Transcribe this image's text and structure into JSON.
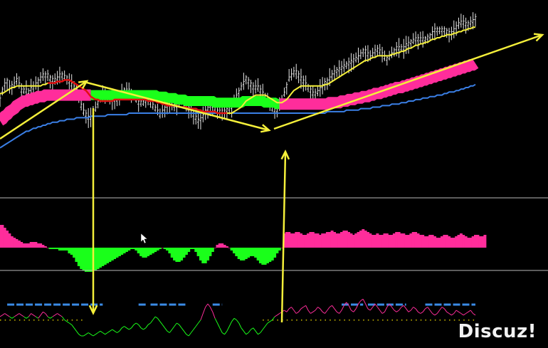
{
  "watermark": "Discuz!",
  "colors": {
    "background": "#000000",
    "price_bar": "#e6e6e6",
    "fast_ma": "#f4ef3a",
    "mid_ma_up": "#ff2d9b",
    "mid_ma_down": "#1aff1a",
    "slow_ma": "#3a7fe6",
    "red_ma": "#e01010",
    "annotation": "#f4ef3a",
    "separator": "#b8b8b8",
    "histogram_pos": "#ff2d9b",
    "histogram_neg": "#1aff1a",
    "osc_pos": "#ff2d9b",
    "osc_neg": "#1aff1a",
    "signal_dash": "#3a8be6",
    "zero_dots": "#d4c000"
  },
  "chart_data": [
    {
      "type": "line",
      "panel": "price",
      "bars": 200,
      "close": [
        34,
        40,
        44,
        46,
        42,
        43,
        44,
        47,
        44,
        40,
        40,
        40,
        39,
        41,
        42,
        44,
        46,
        48,
        50,
        50,
        50,
        48,
        47,
        47,
        48,
        50,
        50,
        49,
        48,
        46,
        44,
        42,
        40,
        36,
        30,
        26,
        24,
        22,
        22,
        24,
        28,
        32,
        36,
        38,
        38,
        37,
        35,
        34,
        34,
        34,
        36,
        38,
        40,
        40,
        40,
        38,
        36,
        34,
        32,
        32,
        32,
        33,
        34,
        32,
        30,
        28,
        26,
        24,
        26,
        28,
        30,
        32,
        32,
        30,
        30,
        32,
        34,
        33,
        30,
        28,
        26,
        24,
        22,
        20,
        21,
        23,
        26,
        28,
        30,
        30,
        28,
        26,
        26,
        26,
        26,
        27,
        28,
        29,
        32,
        36,
        39,
        42,
        45,
        48,
        46,
        44,
        42,
        42,
        42,
        40,
        38,
        36,
        34,
        31,
        28,
        27,
        27,
        29,
        33,
        38,
        43,
        48,
        50,
        52,
        52,
        50,
        48,
        46,
        44,
        42,
        40,
        38,
        38,
        39,
        41,
        43,
        45,
        46,
        48,
        50,
        52,
        53,
        54,
        55,
        56,
        57,
        58,
        59,
        60,
        61,
        62,
        64,
        66,
        66,
        64,
        62,
        64,
        66,
        67,
        66,
        64,
        62,
        61,
        62,
        64,
        66,
        68,
        68,
        68,
        68,
        70,
        71,
        72,
        73,
        74,
        74,
        74,
        74,
        74,
        75,
        76,
        78,
        80,
        80,
        80,
        80,
        80,
        79,
        78,
        78,
        80,
        82,
        84,
        85,
        85,
        84,
        84,
        85,
        86,
        88
      ],
      "fast_ma": [
        38,
        38,
        39,
        40,
        41,
        42,
        42,
        43,
        43,
        43,
        43,
        43,
        43,
        43,
        43,
        43,
        43,
        43,
        44,
        44,
        45,
        45,
        45,
        45,
        46,
        46,
        46,
        47,
        47,
        47,
        46,
        45,
        44,
        43,
        42,
        41,
        40,
        38,
        36,
        35,
        34,
        34,
        33,
        33,
        33,
        33,
        33,
        33,
        34,
        34,
        34,
        34,
        34,
        34,
        34,
        34,
        34,
        34,
        34,
        34,
        34,
        34,
        33,
        33,
        33,
        33,
        32,
        32,
        31,
        31,
        30,
        30,
        30,
        30,
        30,
        29,
        29,
        29,
        29,
        28,
        28,
        28,
        28,
        27,
        27,
        26,
        26,
        26,
        26,
        26,
        26,
        25,
        25,
        25,
        25,
        25,
        25,
        25,
        26,
        27,
        28,
        29,
        31,
        33,
        34,
        35,
        36,
        37,
        37,
        37,
        37,
        37,
        36,
        35,
        34,
        33,
        32,
        32,
        32,
        33,
        34,
        36,
        38,
        40,
        41,
        42,
        43,
        43,
        43,
        43,
        43,
        43,
        43,
        43,
        43,
        43,
        44,
        44,
        45,
        46,
        47,
        48,
        49,
        50,
        51,
        52,
        53,
        54,
        55,
        56,
        57,
        58,
        59,
        60,
        60,
        61,
        62,
        62,
        63,
        63,
        63,
        63,
        63,
        63,
        64,
        64,
        65,
        65,
        66,
        66,
        67,
        68,
        68,
        69,
        70,
        70,
        71,
        71,
        72,
        72,
        73,
        74,
        74,
        75,
        75,
        76,
        76,
        77,
        77,
        77,
        78,
        78,
        79,
        79,
        80,
        80,
        81,
        81,
        82,
        82
      ],
      "mid_ma": [
        20,
        21,
        23,
        24,
        26,
        27,
        28,
        30,
        31,
        32,
        33,
        33,
        34,
        34,
        35,
        35,
        36,
        36,
        36,
        37,
        37,
        37,
        37,
        37,
        37,
        37,
        37,
        37,
        37,
        37,
        37,
        37,
        37,
        37,
        37,
        37,
        37,
        37,
        37,
        37,
        37,
        37,
        37,
        37,
        37,
        37,
        37,
        37,
        37,
        37,
        37,
        37,
        37,
        37,
        37,
        37,
        37,
        37,
        37,
        37,
        37,
        37,
        37,
        37,
        37,
        37,
        36,
        36,
        36,
        36,
        35,
        35,
        35,
        35,
        34,
        34,
        34,
        34,
        33,
        33,
        33,
        33,
        33,
        33,
        33,
        33,
        33,
        33,
        33,
        33,
        32,
        32,
        32,
        32,
        32,
        32,
        32,
        32,
        32,
        32,
        32,
        32,
        33,
        33,
        33,
        33,
        33,
        33,
        33,
        33,
        33,
        32,
        32,
        32,
        32,
        32,
        31,
        31,
        31,
        31,
        31,
        31,
        31,
        31,
        31,
        31,
        31,
        31,
        31,
        31,
        31,
        31,
        31,
        31,
        31,
        31,
        31,
        31,
        32,
        32,
        32,
        32,
        32,
        33,
        33,
        33,
        34,
        34,
        34,
        35,
        35,
        35,
        36,
        36,
        36,
        37,
        37,
        38,
        38,
        38,
        39,
        39,
        40,
        40,
        41,
        41,
        42,
        42,
        42,
        43,
        43,
        44,
        44,
        45,
        45,
        46,
        46,
        47,
        47,
        48,
        48,
        49,
        49,
        50,
        50,
        51,
        51,
        52,
        52,
        53,
        53,
        54,
        54,
        55,
        55,
        56,
        56,
        57,
        57,
        58,
        58
      ],
      "slow_ma": [
        2,
        3,
        4,
        5,
        6,
        7,
        8,
        9,
        10,
        11,
        12,
        13,
        13,
        14,
        15,
        15,
        16,
        16,
        17,
        17,
        18,
        18,
        19,
        19,
        19,
        20,
        20,
        20,
        21,
        21,
        21,
        21,
        22,
        22,
        22,
        22,
        22,
        22,
        23,
        23,
        23,
        23,
        23,
        23,
        23,
        24,
        24,
        24,
        24,
        24,
        24,
        24,
        24,
        24,
        25,
        25,
        25,
        25,
        25,
        25,
        25,
        25,
        25,
        25,
        25,
        25,
        25,
        25,
        25,
        25,
        25,
        25,
        25,
        25,
        25,
        25,
        25,
        25,
        25,
        25,
        25,
        25,
        25,
        25,
        25,
        25,
        25,
        25,
        25,
        25,
        25,
        25,
        25,
        25,
        25,
        25,
        25,
        25,
        25,
        25,
        25,
        25,
        25,
        25,
        25,
        25,
        25,
        25,
        25,
        25,
        25,
        25,
        25,
        25,
        25,
        25,
        25,
        25,
        25,
        25,
        25,
        25,
        25,
        25,
        25,
        25,
        25,
        25,
        25,
        25,
        25,
        25,
        25,
        25,
        25,
        25,
        25,
        26,
        26,
        26,
        26,
        26,
        26,
        26,
        26,
        27,
        27,
        27,
        27,
        27,
        27,
        28,
        28,
        28,
        28,
        28,
        29,
        29,
        29,
        29,
        30,
        30,
        30,
        30,
        31,
        31,
        31,
        31,
        32,
        32,
        32,
        33,
        33,
        33,
        34,
        34,
        34,
        35,
        35,
        35,
        36,
        36,
        36,
        37,
        37,
        37,
        38,
        38,
        39,
        39,
        39,
        40,
        40,
        41,
        41,
        42,
        42,
        43,
        43,
        44,
        44,
        45
      ],
      "red_ma_segment": [
        20,
        95
      ],
      "mid_ma_down_segment": [
        38,
        117
      ]
    },
    {
      "type": "bar",
      "panel": "histogram",
      "values": [
        0.8,
        0.8,
        0.7,
        0.6,
        0.5,
        0.4,
        0.35,
        0.3,
        0.25,
        0.2,
        0.15,
        0.15,
        0.15,
        0.2,
        0.2,
        0.2,
        0.15,
        0.15,
        0.1,
        0.05,
        0.0,
        -0.05,
        -0.05,
        -0.05,
        -0.05,
        -0.1,
        -0.1,
        -0.1,
        -0.1,
        -0.2,
        -0.25,
        -0.35,
        -0.5,
        -0.65,
        -0.75,
        -0.8,
        -0.85,
        -0.85,
        -0.85,
        -0.8,
        -0.8,
        -0.75,
        -0.7,
        -0.65,
        -0.6,
        -0.55,
        -0.5,
        -0.45,
        -0.4,
        -0.35,
        -0.3,
        -0.25,
        -0.2,
        -0.15,
        -0.1,
        -0.05,
        -0.05,
        -0.1,
        -0.2,
        -0.3,
        -0.35,
        -0.35,
        -0.3,
        -0.25,
        -0.2,
        -0.15,
        -0.1,
        -0.05,
        0.0,
        -0.05,
        -0.1,
        -0.2,
        -0.35,
        -0.45,
        -0.5,
        -0.5,
        -0.45,
        -0.35,
        -0.25,
        -0.15,
        -0.05,
        -0.05,
        -0.15,
        -0.3,
        -0.45,
        -0.55,
        -0.55,
        -0.45,
        -0.3,
        -0.15,
        0.0,
        0.1,
        0.15,
        0.15,
        0.1,
        0.05,
        0.0,
        -0.1,
        -0.2,
        -0.3,
        -0.4,
        -0.45,
        -0.45,
        -0.4,
        -0.35,
        -0.3,
        -0.3,
        -0.35,
        -0.45,
        -0.55,
        -0.6,
        -0.6,
        -0.55,
        -0.5,
        -0.45,
        -0.35,
        -0.2,
        -0.1,
        0.0,
        0.5,
        0.55,
        0.55,
        0.5,
        0.5,
        0.55,
        0.55,
        0.5,
        0.45,
        0.45,
        0.5,
        0.55,
        0.55,
        0.5,
        0.5,
        0.45,
        0.5,
        0.5,
        0.55,
        0.55,
        0.6,
        0.55,
        0.5,
        0.5,
        0.55,
        0.6,
        0.6,
        0.55,
        0.5,
        0.45,
        0.5,
        0.55,
        0.6,
        0.65,
        0.6,
        0.55,
        0.5,
        0.45,
        0.45,
        0.5,
        0.45,
        0.45,
        0.5,
        0.5,
        0.45,
        0.45,
        0.5,
        0.55,
        0.55,
        0.5,
        0.5,
        0.45,
        0.45,
        0.5,
        0.55,
        0.55,
        0.5,
        0.45,
        0.45,
        0.4,
        0.4,
        0.45,
        0.45,
        0.4,
        0.35,
        0.35,
        0.4,
        0.45,
        0.45,
        0.4,
        0.35,
        0.35,
        0.4,
        0.45,
        0.5,
        0.45,
        0.4,
        0.35,
        0.35,
        0.4,
        0.45,
        0.45,
        0.4,
        0.4,
        0.45
      ]
    },
    {
      "type": "line",
      "panel": "oscillator",
      "values": [
        0.0,
        0.05,
        0.1,
        0.05,
        0.0,
        -0.05,
        0.0,
        0.05,
        0.1,
        0.05,
        0.0,
        -0.05,
        0.0,
        0.1,
        0.05,
        0.0,
        -0.05,
        0.05,
        0.15,
        0.1,
        0.0,
        -0.05,
        0.0,
        0.05,
        0.1,
        0.05,
        0.0,
        -0.1,
        -0.15,
        -0.2,
        -0.25,
        -0.35,
        -0.45,
        -0.55,
        -0.6,
        -0.6,
        -0.55,
        -0.5,
        -0.55,
        -0.6,
        -0.55,
        -0.5,
        -0.45,
        -0.5,
        -0.55,
        -0.5,
        -0.45,
        -0.4,
        -0.45,
        -0.5,
        -0.45,
        -0.35,
        -0.3,
        -0.35,
        -0.4,
        -0.35,
        -0.25,
        -0.2,
        -0.25,
        -0.35,
        -0.4,
        -0.35,
        -0.25,
        -0.2,
        -0.1,
        0.0,
        -0.05,
        -0.15,
        -0.25,
        -0.35,
        -0.45,
        -0.5,
        -0.4,
        -0.3,
        -0.2,
        -0.25,
        -0.35,
        -0.45,
        -0.55,
        -0.6,
        -0.5,
        -0.4,
        -0.3,
        -0.2,
        -0.1,
        0.1,
        0.3,
        0.4,
        0.3,
        0.15,
        -0.05,
        -0.2,
        -0.35,
        -0.5,
        -0.55,
        -0.45,
        -0.3,
        -0.15,
        -0.05,
        -0.1,
        -0.2,
        -0.35,
        -0.45,
        -0.55,
        -0.5,
        -0.4,
        -0.35,
        -0.45,
        -0.55,
        -0.5,
        -0.4,
        -0.3,
        -0.2,
        -0.15,
        -0.1,
        0.0,
        0.05,
        0.1,
        0.15,
        0.2,
        0.15,
        0.25,
        0.3,
        0.2,
        0.1,
        0.15,
        0.25,
        0.3,
        0.35,
        0.2,
        0.1,
        0.15,
        0.2,
        0.3,
        0.25,
        0.15,
        0.1,
        0.2,
        0.3,
        0.35,
        0.25,
        0.15,
        0.1,
        0.2,
        0.35,
        0.45,
        0.35,
        0.2,
        0.15,
        0.25,
        0.4,
        0.5,
        0.55,
        0.4,
        0.25,
        0.2,
        0.3,
        0.4,
        0.3,
        0.2,
        0.1,
        0.15,
        0.3,
        0.4,
        0.3,
        0.2,
        0.15,
        0.2,
        0.3,
        0.35,
        0.25,
        0.15,
        0.2,
        0.3,
        0.25,
        0.15,
        0.1,
        0.15,
        0.25,
        0.3,
        0.2,
        0.1,
        0.05,
        0.1,
        0.2,
        0.3,
        0.25,
        0.15,
        0.1,
        0.05,
        0.1,
        0.2,
        0.15,
        0.1,
        0.05,
        0.1,
        0.15,
        0.2,
        0.1,
        0.05,
        0.1,
        0.15
      ],
      "signal_dash_segments": [
        [
          3,
          43
        ],
        [
          58,
          61
        ],
        [
          63,
          78
        ],
        [
          89,
          93
        ],
        [
          143,
          152
        ],
        [
          154,
          170
        ],
        [
          178,
          200
        ]
      ],
      "zero_dot_segments": [
        [
          0,
          36
        ],
        [
          110,
          200
        ]
      ]
    }
  ]
}
